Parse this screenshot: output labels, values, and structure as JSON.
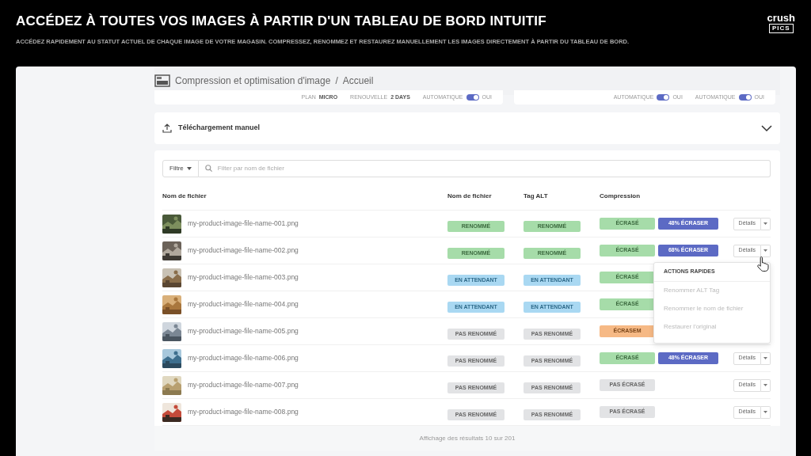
{
  "header": {
    "title": "ACCÉDEZ À TOUTES VOS IMAGES À PARTIR D'UN TABLEAU DE BORD INTUITIF",
    "subtitle": "ACCÉDEZ RAPIDEMENT AU STATUT ACTUEL DE CHAQUE IMAGE DE VOTRE MAGASIN. COMPRESSEZ, RENOMMEZ ET RESTAUREZ MANUELLEMENT LES IMAGES DIRECTEMENT À PARTIR DU TABLEAU DE BORD.",
    "logo_top": "crush",
    "logo_bottom": "PICS"
  },
  "breadcrumb_separator": "/",
  "breadcrumb": [
    {
      "label": "Compression et optimisation d'image"
    },
    {
      "label": "Accueil"
    }
  ],
  "stat_cards": [
    {
      "items": [
        {
          "kind": "text",
          "label": "PLAN",
          "value": "MICRO"
        },
        {
          "kind": "text",
          "label": "RENOUVELLE",
          "value": "2 DAYS"
        },
        {
          "kind": "toggle",
          "label": "AUTOMATIQUE",
          "value": "OUI",
          "on": true
        }
      ]
    },
    {
      "items": [
        {
          "kind": "toggle",
          "label": "AUTOMATIQUE",
          "value": "OUI",
          "on": true
        },
        {
          "kind": "toggle",
          "label": "AUTOMATIQUE",
          "value": "OUI",
          "on": true
        }
      ]
    }
  ],
  "upload": {
    "label": "Téléchargement manuel",
    "expanded": false
  },
  "filter": {
    "button": "Filtre",
    "placeholder": "Filter par nom de fichier"
  },
  "table": {
    "columns": [
      "Nom de fichier",
      "Nom de fichier",
      "Tag ALT",
      "Compression"
    ],
    "rows": [
      {
        "file": "my-product-image-file-name-001.png",
        "name_status": {
          "kind": "done",
          "label": "RENOMMÉ"
        },
        "alt_status": {
          "kind": "done",
          "label": "RENOMMÉ"
        },
        "compression": {
          "kind": "done",
          "label": "ÉCRASÉ"
        },
        "savings": "48% ÉCRASER",
        "details": "Détails"
      },
      {
        "file": "my-product-image-file-name-002.png",
        "name_status": {
          "kind": "done",
          "label": "RENOMMÉ"
        },
        "alt_status": {
          "kind": "done",
          "label": "RENOMMÉ"
        },
        "compression": {
          "kind": "done",
          "label": "ÉCRASÉ"
        },
        "savings": "68% ÉCRASER",
        "details": "Détails"
      },
      {
        "file": "my-product-image-file-name-003.png",
        "name_status": {
          "kind": "pending",
          "label": "EN ATTENDANT"
        },
        "alt_status": {
          "kind": "pending",
          "label": "EN ATTENDANT"
        },
        "compression": {
          "kind": "done",
          "label": "ÉCRASÉ"
        }
      },
      {
        "file": "my-product-image-file-name-004.png",
        "name_status": {
          "kind": "pending",
          "label": "EN ATTENDANT"
        },
        "alt_status": {
          "kind": "pending",
          "label": "EN ATTENDANT"
        },
        "compression": {
          "kind": "done",
          "label": "ÉCRASÉ"
        }
      },
      {
        "file": "my-product-image-file-name-005.png",
        "name_status": {
          "kind": "none",
          "label": "PAS RENOMMÉ"
        },
        "alt_status": {
          "kind": "none",
          "label": "PAS RENOMMÉ"
        },
        "compression": {
          "kind": "partial",
          "label": "ÉCRASEM"
        }
      },
      {
        "file": "my-product-image-file-name-006.png",
        "name_status": {
          "kind": "none",
          "label": "PAS RENOMMÉ"
        },
        "alt_status": {
          "kind": "none",
          "label": "PAS RENOMMÉ"
        },
        "compression": {
          "kind": "done",
          "label": "ÉCRASÉ"
        },
        "savings": "48% ÉCRASER",
        "details": "Détails"
      },
      {
        "file": "my-product-image-file-name-007.png",
        "name_status": {
          "kind": "none",
          "label": "PAS RENOMMÉ"
        },
        "alt_status": {
          "kind": "none",
          "label": "PAS RENOMMÉ"
        },
        "compression": {
          "kind": "none",
          "label": "PAS ÉCRASÉ"
        },
        "details": "Détails"
      },
      {
        "file": "my-product-image-file-name-008.png",
        "name_status": {
          "kind": "none",
          "label": "PAS RENOMMÉ"
        },
        "alt_status": {
          "kind": "none",
          "label": "PAS RENOMMÉ"
        },
        "compression": {
          "kind": "none",
          "label": "PAS ÉCRASÉ"
        },
        "details": "Détails"
      }
    ]
  },
  "quick_actions": {
    "title": "ACTIONS RAPIDES",
    "items": [
      {
        "label": "Renommer ALT Tag",
        "disabled": true
      },
      {
        "label": "Renommer le nom de fichier",
        "disabled": true
      },
      {
        "label": "Restaurer l'original",
        "disabled": true
      }
    ]
  },
  "footer": "Affichage des résultats 10 sur 201"
}
